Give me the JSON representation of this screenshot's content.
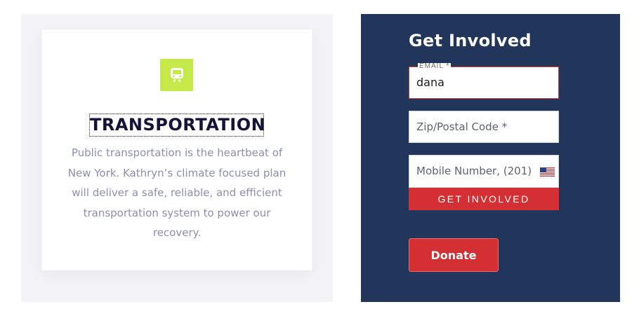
{
  "service_card": {
    "icon": "train-icon",
    "icon_color": "#c6e94a",
    "title": "TRANSPORTATION",
    "description": "Public transportation is the heartbeat of New York. Kathryn’s climate focused plan will deliver a safe, reliable, and efficient transportation system to power our recovery."
  },
  "signup_form": {
    "heading": "Get Involved",
    "email": {
      "label": "EMAIL *",
      "value": "dana"
    },
    "zip": {
      "placeholder": "Zip/Postal Code *"
    },
    "mobile": {
      "placeholder": "Mobile Number, (201)",
      "country_icon": "us-flag-icon"
    },
    "submit_label": "GET INVOLVED",
    "donate_label": "Donate",
    "accent_color": "#d43033",
    "background_color": "#22355a"
  }
}
